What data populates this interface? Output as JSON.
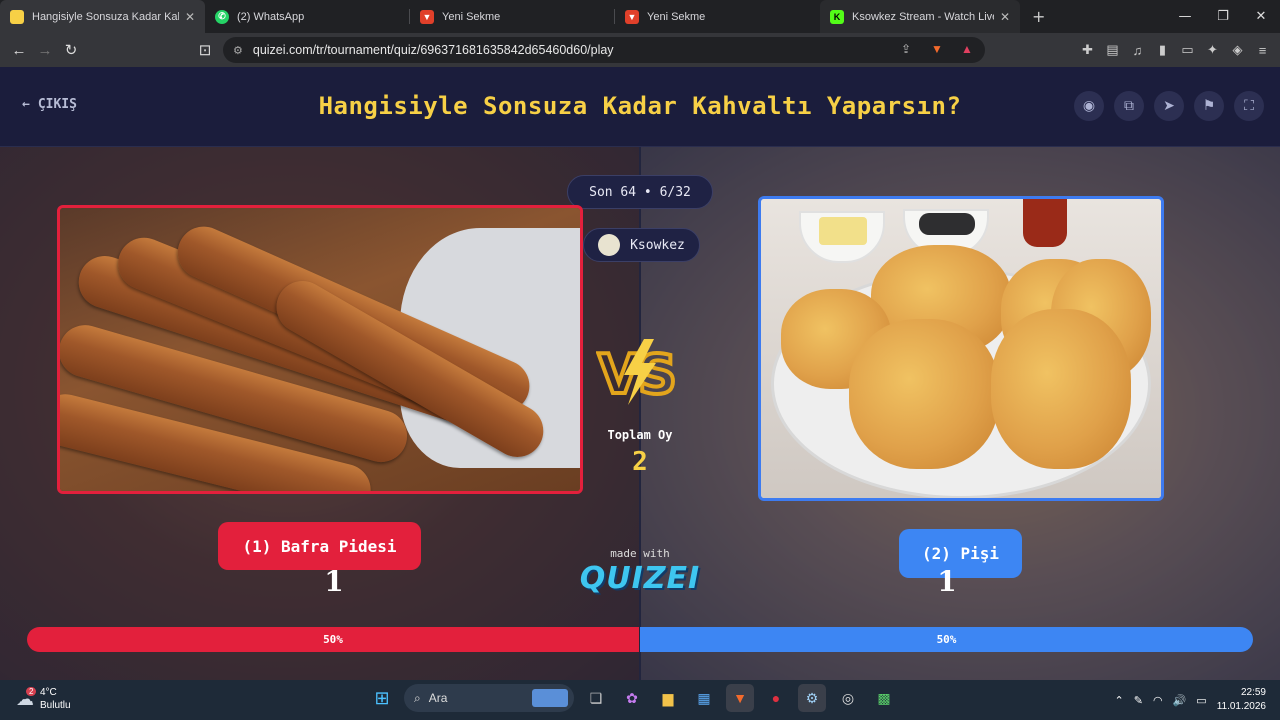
{
  "browser": {
    "tabs": [
      {
        "label": "Hangisiyle Sonsuza Kadar Kahvalt",
        "active": true,
        "icon": "quizei-favicon"
      },
      {
        "label": "(2) WhatsApp",
        "active": false,
        "icon": "whatsapp-icon"
      },
      {
        "label": "Yeni Sekme",
        "active": false,
        "icon": "brave-icon"
      },
      {
        "label": "Yeni Sekme",
        "active": false,
        "icon": "brave-icon"
      },
      {
        "label": "Ksowkez Stream - Watch Live on",
        "active": false,
        "icon": "kick-icon"
      }
    ],
    "url": "quizei.com/tr/tournament/quiz/696371681635842d65460d60/play",
    "shield_badge": "6",
    "alert_badge": "1"
  },
  "header": {
    "exit_label": "ÇIKIŞ",
    "title": "Hangisiyle Sonsuza Kadar Kahvaltı Yaparsın?"
  },
  "round": {
    "label": "Son 64 • 6/32",
    "streamer": "Ksowkez"
  },
  "vs": {
    "total_label": "Toplam Oy",
    "total_value": "2"
  },
  "left": {
    "label": "(1) Bafra Pidesi",
    "votes": "1",
    "percent": "50%",
    "color": "#e3203c"
  },
  "right": {
    "label": "(2) Pişi",
    "votes": "1",
    "percent": "50%",
    "color": "#3d86f3"
  },
  "branding": {
    "made_with": "made with",
    "logo": "QUIZEI"
  },
  "taskbar": {
    "weather_temp": "4°C",
    "weather_desc": "Bulutlu",
    "weather_badge": "2",
    "search_placeholder": "Ara",
    "time": "22:59",
    "date": "11.01.2026"
  }
}
